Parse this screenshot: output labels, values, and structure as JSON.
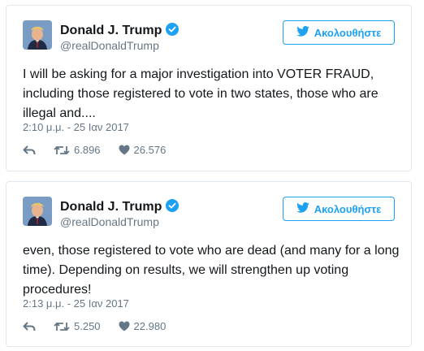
{
  "tweets": [
    {
      "name": "Donald J. Trump",
      "handle": "@realDonaldTrump",
      "follow_label": "Ακολουθήστε",
      "text": "I will be asking for a major investigation into VOTER FRAUD, including those registered to vote in two states, those who are illegal and....",
      "timestamp": "2:10 μ.μ. - 25 Ιαν 2017",
      "retweets": "6.896",
      "likes": "26.576"
    },
    {
      "name": "Donald J. Trump",
      "handle": "@realDonaldTrump",
      "follow_label": "Ακολουθήστε",
      "text": "even, those registered to vote who are dead (and many for a long time). Depending on results, we will strengthen up voting procedures!",
      "timestamp": "2:13 μ.μ. - 25 Ιαν 2017",
      "retweets": "5.250",
      "likes": "22.980"
    }
  ],
  "colors": {
    "accent": "#1da1f2",
    "secondary_text": "#657786",
    "border": "#e1e8ed"
  },
  "icons": [
    "verified-badge-icon",
    "twitter-bird-icon",
    "reply-icon",
    "retweet-icon",
    "like-heart-icon"
  ]
}
